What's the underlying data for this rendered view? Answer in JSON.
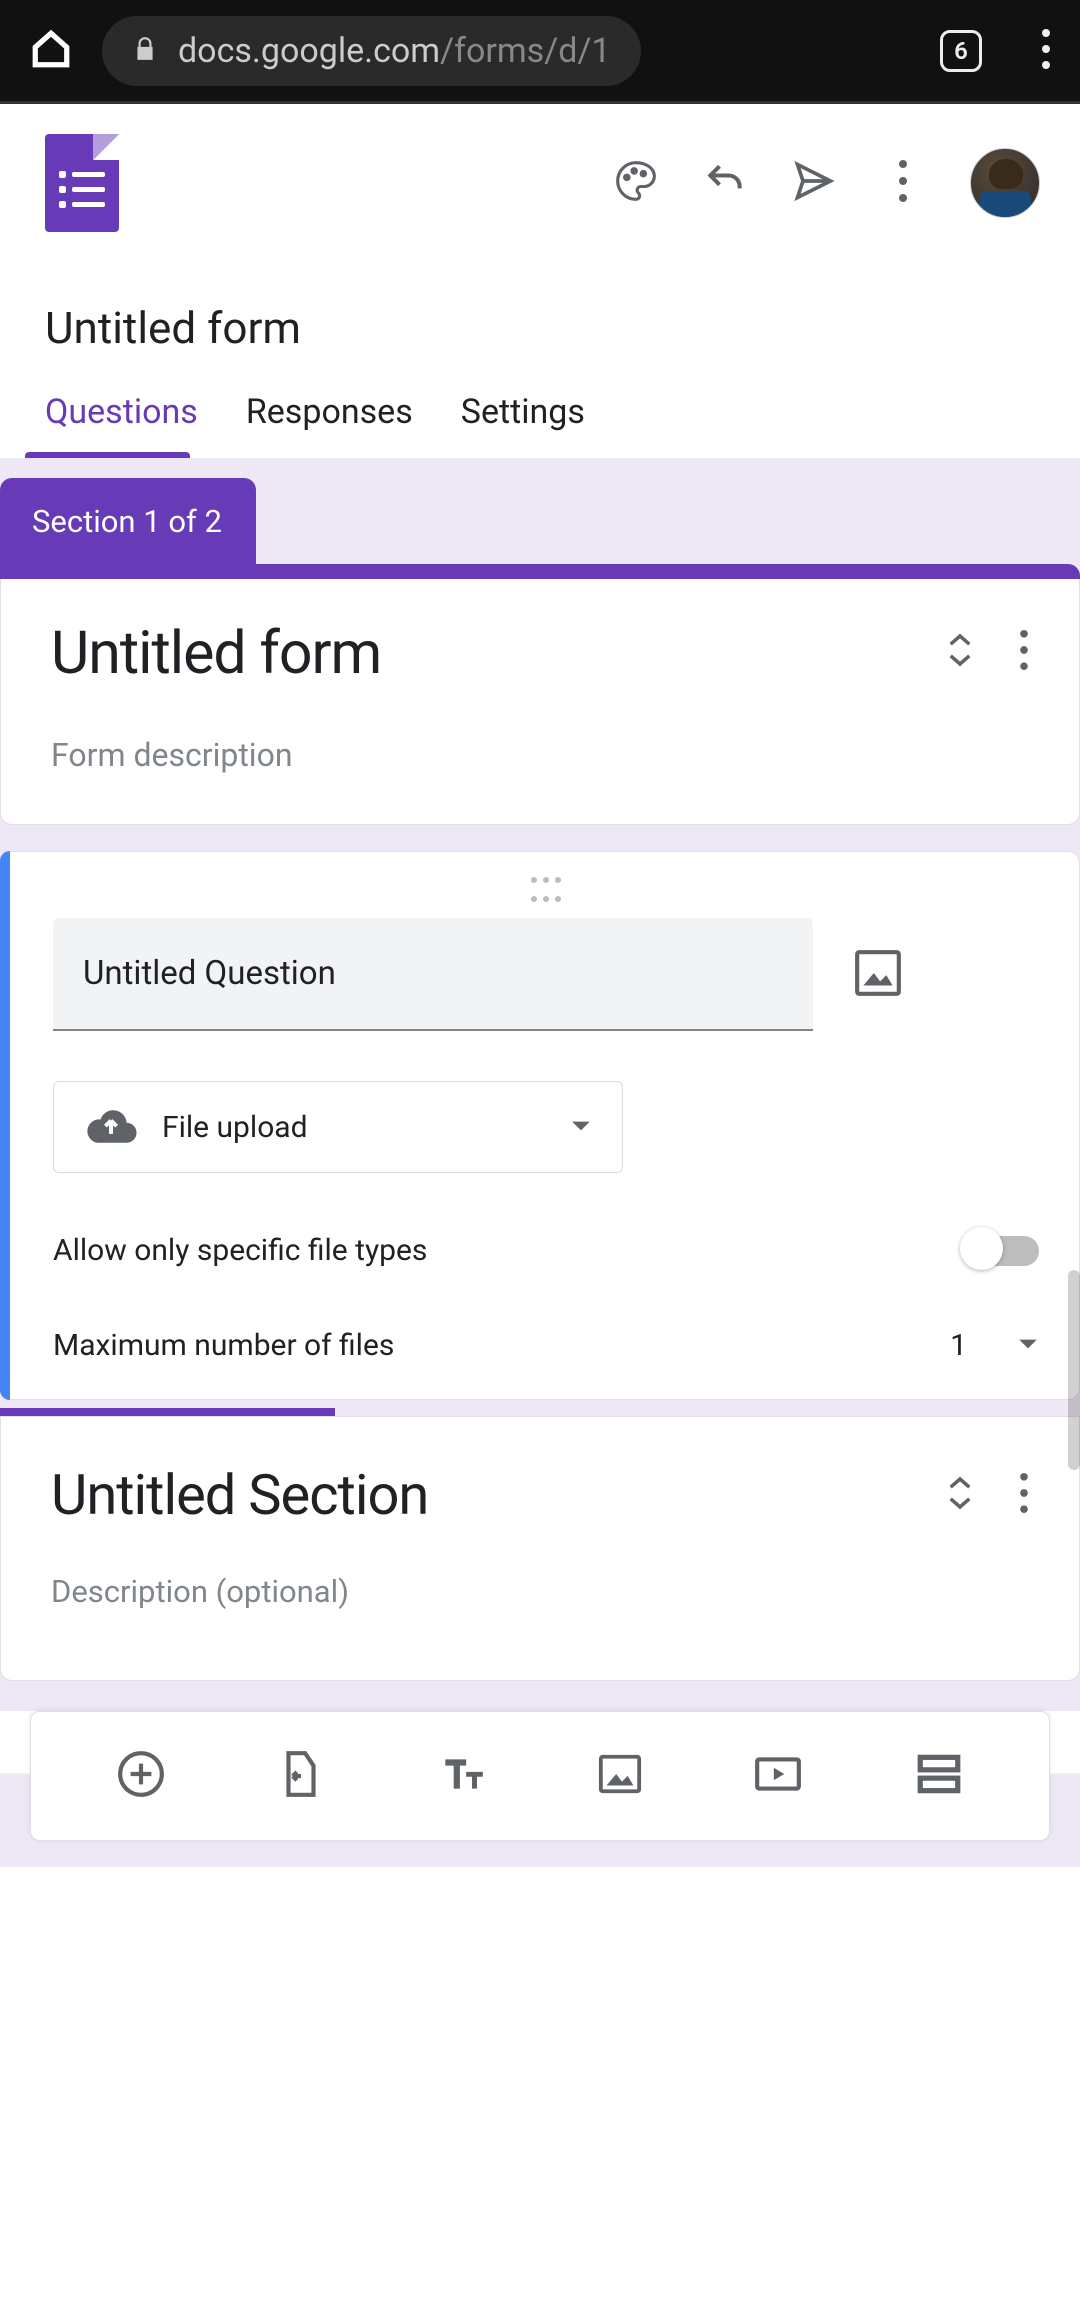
{
  "browser": {
    "url_host": "docs.google.com",
    "url_path": "/forms/d/1",
    "tab_count": "6"
  },
  "header": {
    "form_title": "Untitled form"
  },
  "tabs": {
    "questions": "Questions",
    "responses": "Responses",
    "settings": "Settings"
  },
  "section_label": "Section 1 of 2",
  "form_card": {
    "title": "Untitled form",
    "description_placeholder": "Form description"
  },
  "question": {
    "title": "Untitled Question",
    "type_label": "File upload",
    "allow_specific_label": "Allow only specific file types",
    "allow_specific_value": false,
    "max_files_label": "Maximum number of files",
    "max_files_value": "1"
  },
  "section2": {
    "title": "Untitled Section",
    "description_placeholder": "Description (optional)"
  },
  "toolbar_icons": [
    "add-question",
    "import-questions",
    "add-title",
    "add-image",
    "add-video",
    "add-section"
  ]
}
